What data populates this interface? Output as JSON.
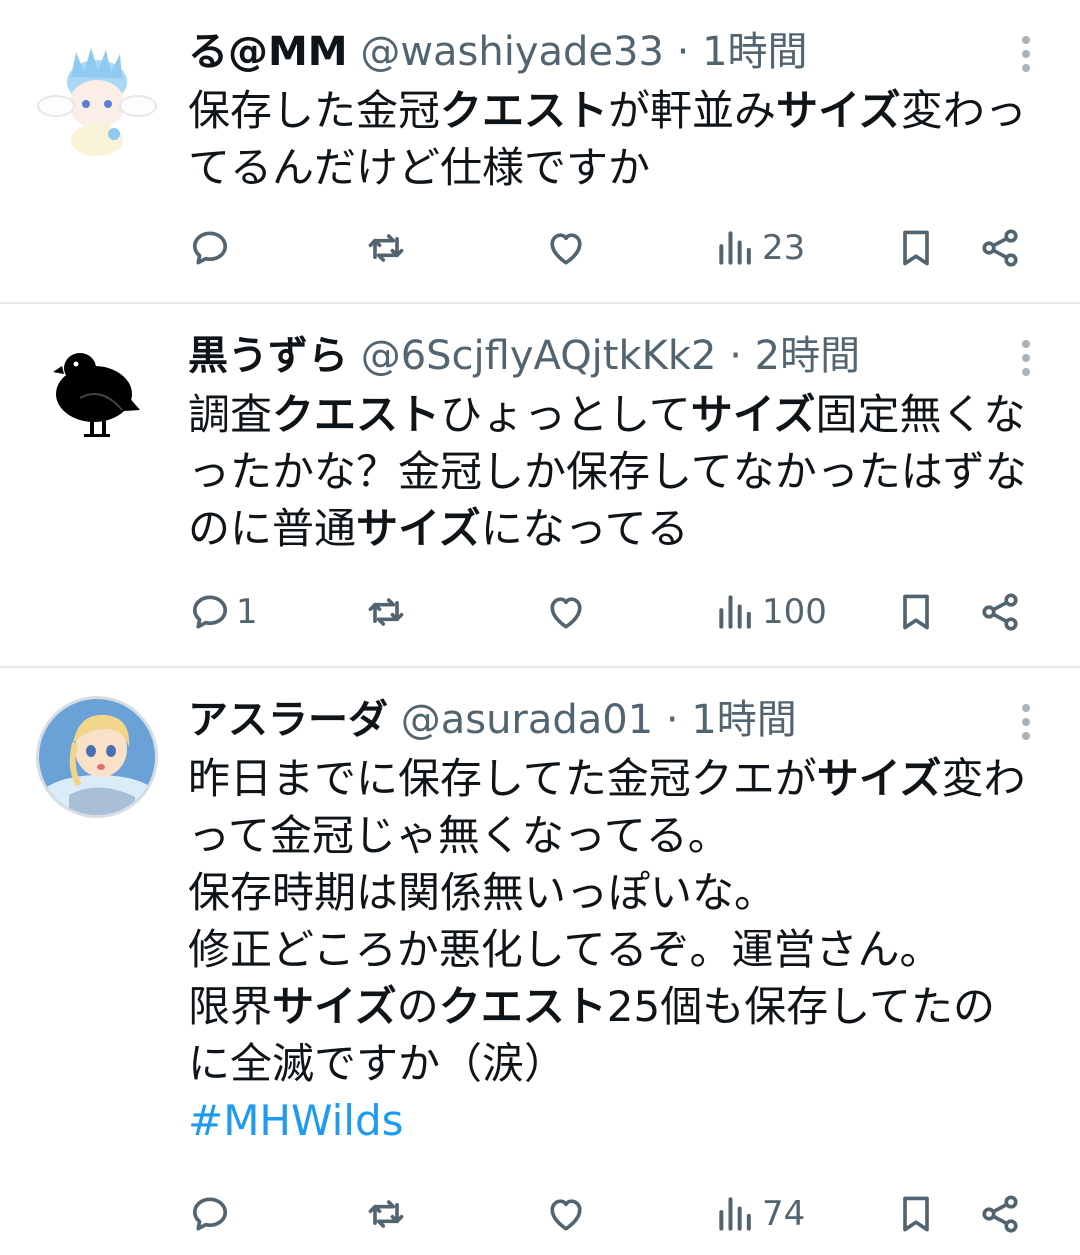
{
  "tweets": [
    {
      "name": "る@MM",
      "handle": "@washiyade33",
      "dot": "·",
      "time": "1時間",
      "body": [
        {
          "t": "保存した金冠",
          "b": false
        },
        {
          "t": "クエスト",
          "b": true
        },
        {
          "t": "が軒並み",
          "b": false
        },
        {
          "t": "サイズ",
          "b": true
        },
        {
          "t": "変わってるんだけど仕様ですか",
          "b": false
        }
      ],
      "hashtag": "",
      "replies": "",
      "views": "23",
      "avatar_icon": "anime-character-avatar"
    },
    {
      "name": "黒うずら",
      "handle": "@6ScjflyAQjtkKk2",
      "dot": "·",
      "time": "2時間",
      "body": [
        {
          "t": "調査",
          "b": false
        },
        {
          "t": "クエスト",
          "b": true
        },
        {
          "t": "ひょっとして",
          "b": false
        },
        {
          "t": "サイズ",
          "b": true
        },
        {
          "t": "固定無くなったかな？金冠しか保存してなかったはずなのに普通",
          "b": false
        },
        {
          "t": "サイズ",
          "b": true
        },
        {
          "t": "になってる",
          "b": false
        }
      ],
      "hashtag": "",
      "replies": "1",
      "views": "100",
      "avatar_icon": "black-bird-avatar"
    },
    {
      "name": "アスラーダ",
      "handle": "@asurada01",
      "dot": "·",
      "time": "1時間",
      "body": [
        {
          "t": "昨日までに保存してた金冠クエが",
          "b": false
        },
        {
          "t": "サイズ",
          "b": true
        },
        {
          "t": "変わって金冠じゃ無くなってる。\n保存時期は関係無いっぽいな。\n修正どころか悪化してるぞ。運営さん。\n限界",
          "b": false
        },
        {
          "t": "サイズ",
          "b": true
        },
        {
          "t": "の",
          "b": false
        },
        {
          "t": "クエスト",
          "b": true
        },
        {
          "t": "25個も保存してたのに全滅ですか（涙）",
          "b": false
        }
      ],
      "hashtag": "#MHWilds",
      "replies": "",
      "views": "74",
      "avatar_icon": "anime-girl-avatar"
    }
  ],
  "icons": {
    "reply": "reply-icon",
    "retweet": "retweet-icon",
    "like": "heart-icon",
    "views": "views-icon",
    "bookmark": "bookmark-icon",
    "share": "share-icon",
    "more": "more-vertical-icon"
  },
  "colors": {
    "text": "#0f1419",
    "secondary": "#536471",
    "link": "#1d9bf0",
    "divider": "#e6e9ec"
  }
}
